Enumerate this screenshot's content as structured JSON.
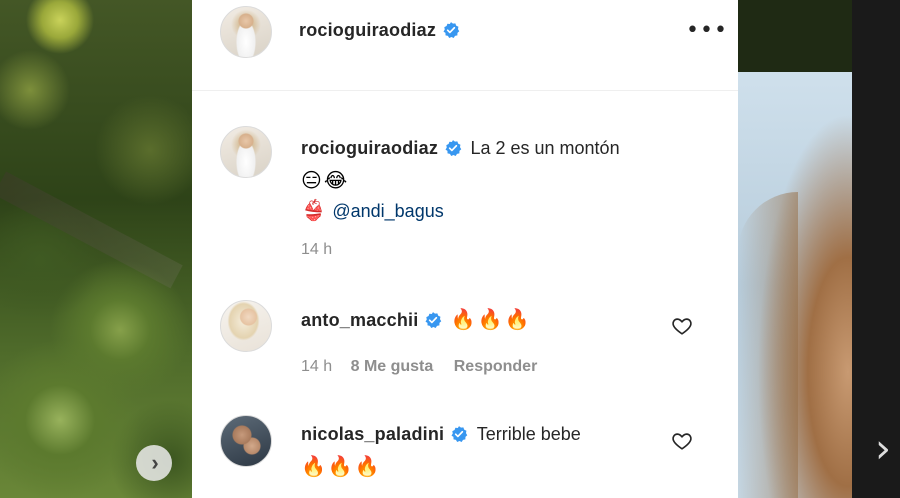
{
  "post": {
    "author": {
      "username": "rocioguiraodiaz",
      "verified": true
    },
    "more_label": "•••"
  },
  "caption": {
    "username": "rocioguiraodiaz",
    "text": "La 2 es un montón",
    "emojis_line": "😑😂",
    "mention_prefix": "👙",
    "mention": "@andi_bagus",
    "time": "14 h"
  },
  "comments": [
    {
      "username": "anto_macchii",
      "verified": true,
      "text": "🔥🔥🔥",
      "time": "14 h",
      "likes": "8 Me gusta",
      "reply": "Responder"
    },
    {
      "username": "nicolas_paladini",
      "verified": true,
      "text": "Terrible bebe",
      "text_line2": "🔥🔥🔥"
    }
  ],
  "icons": {
    "verified": "verified-badge-icon",
    "heart": "heart-icon",
    "more": "more-options-icon",
    "next": "chevron-right-icon"
  },
  "colors": {
    "verified": "#3897f0",
    "link": "#00376b",
    "meta": "#8e8e8e",
    "text": "#262626"
  }
}
